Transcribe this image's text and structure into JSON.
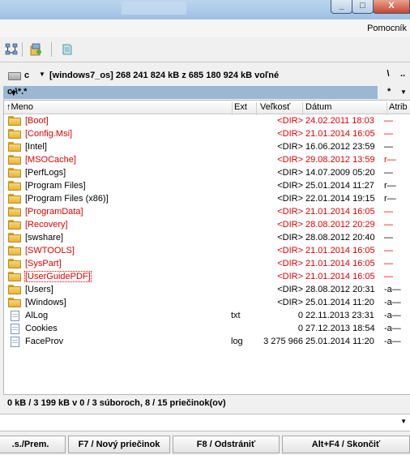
{
  "window": {
    "minimize_label": "_",
    "maximize_label": "□",
    "close_label": "X"
  },
  "menu": {
    "help": "Pomocník"
  },
  "drive": {
    "letter": "c",
    "info": "[windows7_os]  268 241 824 kB z 685 180 924 kB voľné",
    "nav_root": "\\",
    "nav_up": ".."
  },
  "path": {
    "current": "c:\\*.*",
    "filter_star": "*"
  },
  "columns": {
    "name": "Meno",
    "ext": "Ext",
    "size": "Veľkosť",
    "date": "Dátum",
    "attr": "Atrib"
  },
  "files": [
    {
      "name": "[Boot]",
      "ext": "",
      "size": "<DIR>",
      "date": "24.02.2011 18:03",
      "attr": "—",
      "type": "folder",
      "red": true
    },
    {
      "name": "[Config.Msi]",
      "ext": "",
      "size": "<DIR>",
      "date": "21.01.2014 16:05",
      "attr": "—",
      "type": "folder",
      "red": true
    },
    {
      "name": "[Intel]",
      "ext": "",
      "size": "<DIR>",
      "date": "16.06.2012 23:59",
      "attr": "—",
      "type": "folder",
      "red": false
    },
    {
      "name": "[MSOCache]",
      "ext": "",
      "size": "<DIR>",
      "date": "29.08.2012 13:59",
      "attr": "r—",
      "type": "folder",
      "red": true
    },
    {
      "name": "[PerfLogs]",
      "ext": "",
      "size": "<DIR>",
      "date": "14.07.2009 05:20",
      "attr": "—",
      "type": "folder",
      "red": false
    },
    {
      "name": "[Program Files]",
      "ext": "",
      "size": "<DIR>",
      "date": "25.01.2014 11:27",
      "attr": "r—",
      "type": "folder",
      "red": false
    },
    {
      "name": "[Program Files (x86)]",
      "ext": "",
      "size": "<DIR>",
      "date": "22.01.2014 19:15",
      "attr": "r—",
      "type": "folder",
      "red": false
    },
    {
      "name": "[ProgramData]",
      "ext": "",
      "size": "<DIR>",
      "date": "21.01.2014 16:05",
      "attr": "—",
      "type": "folder",
      "red": true
    },
    {
      "name": "[Recovery]",
      "ext": "",
      "size": "<DIR>",
      "date": "28.08.2012 20:29",
      "attr": "—",
      "type": "folder",
      "red": true
    },
    {
      "name": "[swshare]",
      "ext": "",
      "size": "<DIR>",
      "date": "28.08.2012 20:40",
      "attr": "—",
      "type": "folder",
      "red": false
    },
    {
      "name": "[SWTOOLS]",
      "ext": "",
      "size": "<DIR>",
      "date": "21.01.2014 16:05",
      "attr": "—",
      "type": "folder",
      "red": true
    },
    {
      "name": "[SysPart]",
      "ext": "",
      "size": "<DIR>",
      "date": "21.01.2014 16:05",
      "attr": "—",
      "type": "folder",
      "red": true
    },
    {
      "name": "[UserGuidePDF]",
      "ext": "",
      "size": "<DIR>",
      "date": "21.01.2014 16:05",
      "attr": "—",
      "type": "folder",
      "red": true,
      "focus": true
    },
    {
      "name": "[Users]",
      "ext": "",
      "size": "<DIR>",
      "date": "28.08.2012 20:31",
      "attr": "-a—",
      "type": "folder",
      "red": false
    },
    {
      "name": "[Windows]",
      "ext": "",
      "size": "<DIR>",
      "date": "25.01.2014 11:20",
      "attr": "-a—",
      "type": "folder",
      "red": false
    },
    {
      "name": "AlLog",
      "ext": "txt",
      "size": "0",
      "date": "22.11.2013 23:31",
      "attr": "-a—",
      "type": "file",
      "red": false
    },
    {
      "name": "Cookies",
      "ext": "",
      "size": "0",
      "date": "27.12.2013 18:54",
      "attr": "-a—",
      "type": "file",
      "red": false
    },
    {
      "name": "FaceProv",
      "ext": "log",
      "size": "3 275 966",
      "date": "25.01.2014 11:20",
      "attr": "-a—",
      "type": "file",
      "red": false
    }
  ],
  "status": "0 kB / 3 199 kB v 0 / 3 súboroch, 8 / 15 priečinok(ov)",
  "fkeys": [
    ".s./Prem.",
    "F7 / Nový priečinok",
    "F8 / Odstrániť",
    "Alt+F4 / Skončiť"
  ],
  "colors": {
    "red_text": "#e00000",
    "path_bar": "#9bb7d4",
    "folder": "#f0c350"
  }
}
